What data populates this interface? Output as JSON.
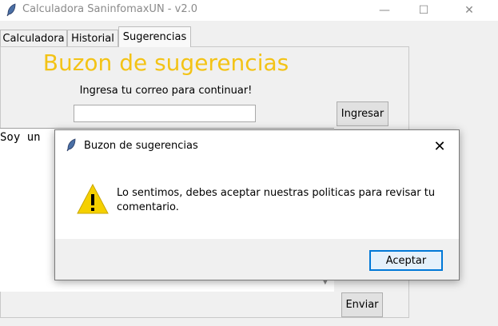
{
  "window": {
    "title": "Calculadora SaninfomaxUN - v2.0",
    "controls": {
      "minimize": "—",
      "maximize": "☐",
      "close": "✕"
    }
  },
  "tabs": [
    {
      "label": "Calculadora"
    },
    {
      "label": "Historial"
    },
    {
      "label": "Sugerencias",
      "active": true
    }
  ],
  "suggestions": {
    "heading": "Buzon de sugerencias",
    "prompt": "Ingresa tu correo para continuar!",
    "email_value": "",
    "login_label": "Ingresar",
    "comment_text": "Soy un ",
    "send_label": "Enviar"
  },
  "dialog": {
    "title": "Buzon de sugerencias",
    "message": "Lo sentimos, debes aceptar nuestras politicas para revisar tu comentario.",
    "accept_label": "Aceptar",
    "icon": "warning-icon"
  },
  "colors": {
    "heading": "#f3c316",
    "accent": "#0078d7",
    "warning": "#f5d000"
  }
}
